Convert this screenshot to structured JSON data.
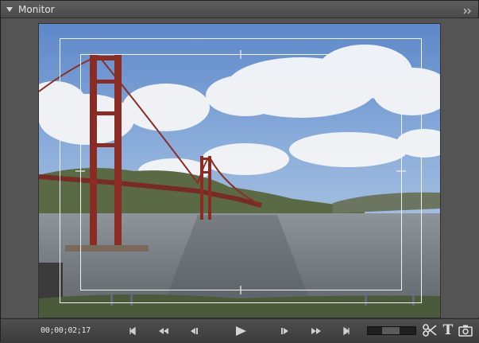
{
  "panel": {
    "title": "Monitor",
    "collapse_icon": "triangle-down-icon",
    "menu_icon": "double-chevron-right-icon"
  },
  "monitor": {
    "overlays": [
      "title-safe-margin",
      "action-safe-margin"
    ]
  },
  "transport": {
    "timecode": "00;00;02;17",
    "buttons": [
      {
        "name": "go-to-in-point",
        "icon": "go-to-in-icon"
      },
      {
        "name": "rewind",
        "icon": "rewind-icon"
      },
      {
        "name": "step-back",
        "icon": "step-back-icon"
      },
      {
        "name": "play",
        "icon": "play-icon"
      },
      {
        "name": "step-forward",
        "icon": "step-forward-icon"
      },
      {
        "name": "fast-forward",
        "icon": "fast-forward-icon"
      },
      {
        "name": "go-to-out-point",
        "icon": "go-to-out-icon"
      }
    ],
    "tools": [
      {
        "name": "split-clip",
        "icon": "scissors-icon"
      },
      {
        "name": "add-text",
        "icon": "text-t-icon",
        "label": "T"
      },
      {
        "name": "freeze-frame",
        "icon": "camera-icon"
      }
    ]
  },
  "colors": {
    "panel_bg": "#4a4a4a",
    "title_text": "#e4e4e4",
    "safe_margin": "#f2f2f2",
    "icon": "#cfcfcf"
  }
}
